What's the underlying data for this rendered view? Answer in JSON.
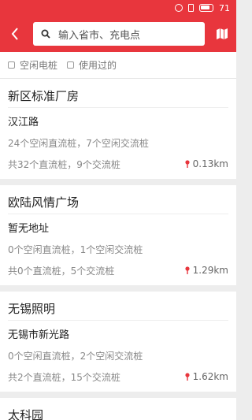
{
  "status_bar": {
    "battery": "71"
  },
  "search": {
    "placeholder": "输入省市、充电点"
  },
  "filters": [
    {
      "label": "空闲电桩"
    },
    {
      "label": "使用过的"
    }
  ],
  "stations": [
    {
      "name": "新区标准厂房",
      "address": "汉江路",
      "free": "24个空闲直流桩，7个空闲交流桩",
      "total": "共32个直流桩，9个交流桩",
      "distance": "0.13km"
    },
    {
      "name": "欧陆风情广场",
      "address": "暂无地址",
      "free": "0个空闲直流桩，1个空闲交流桩",
      "total": "共0个直流桩，5个交流桩",
      "distance": "1.29km"
    },
    {
      "name": "无锡照明",
      "address": "无锡市新光路",
      "free": "0个空闲直流桩，2个空闲交流桩",
      "total": "共2个直流桩，15个交流桩",
      "distance": "1.62km"
    },
    {
      "name": "太科园"
    }
  ],
  "colors": {
    "accent": "#e8363d"
  },
  "icons": {
    "back": "chevron-left-icon",
    "search": "search-icon",
    "map": "map-icon",
    "pin": "location-pin-icon"
  }
}
